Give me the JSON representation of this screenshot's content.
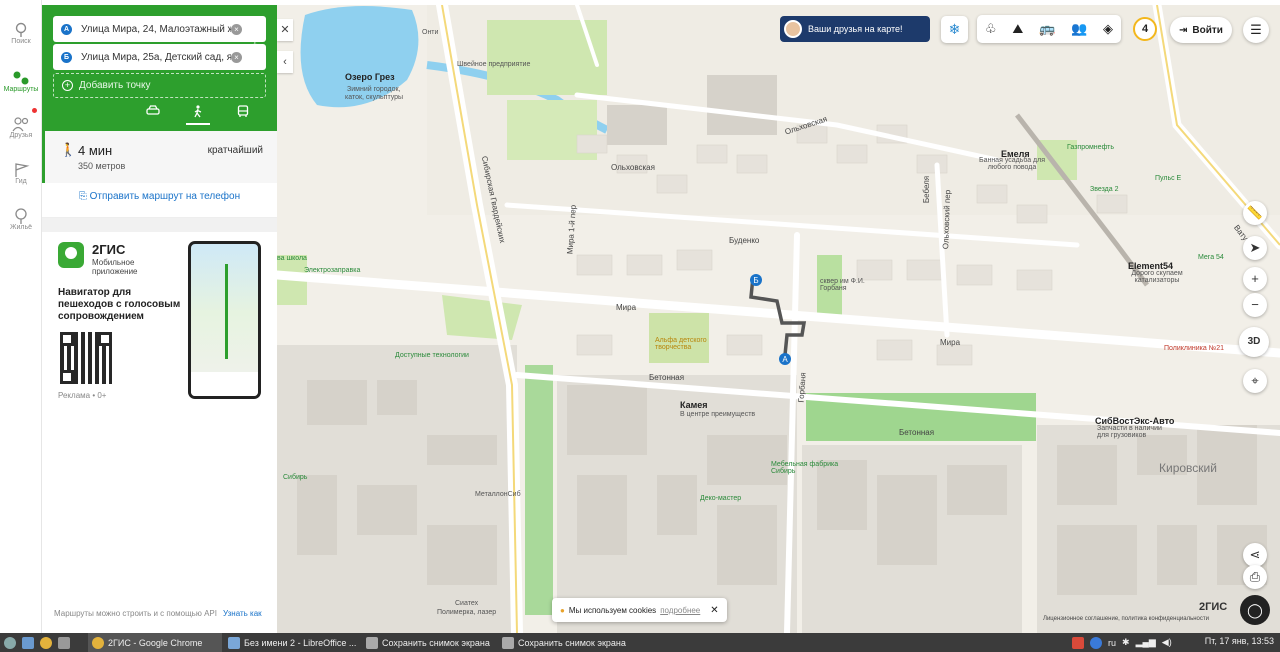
{
  "rail": {
    "items": [
      {
        "label": "Поиск",
        "icon": "search-icon"
      },
      {
        "label": "Маршруты",
        "icon": "routes-icon"
      },
      {
        "label": "Друзья",
        "icon": "friends-icon"
      },
      {
        "label": "Гид",
        "icon": "guide-icon"
      },
      {
        "label": "Жильё",
        "icon": "housing-icon"
      }
    ]
  },
  "route": {
    "point_a": "Улица Мира, 24, Малоэтажный ж",
    "point_b": "Улица Мира, 25а, Детский сад, я",
    "badge_a": "А",
    "badge_b": "Б",
    "add_point": "Добавить точку",
    "modes": [
      "car-icon",
      "walk-icon",
      "bus-icon"
    ],
    "active_mode": "walk-icon",
    "accent_color": "#2d9f2d"
  },
  "result": {
    "time": "4 мин",
    "distance": "350 метров",
    "tag": "кратчайший"
  },
  "send_to_phone": "Отправить маршрут на телефон",
  "ad": {
    "brand": "2ГИС",
    "subtitle": "Мобильное приложение",
    "pitch": "Навигатор для пешеходов с голосовым сопровождением",
    "label": "Реклама • 0+"
  },
  "api": {
    "text": "Маршруты можно строить и с помощью API",
    "link": "Узнать как"
  },
  "map": {
    "friends_banner": "Ваши друзья на карте!",
    "counter": "4",
    "login": "Войти",
    "btn_3d": "3D",
    "cookies_text": "Мы используем cookies",
    "cookies_more": "подробнее",
    "logo": "2ГИС",
    "legal": "Лицензионное соглашение, политика конфиденциальности",
    "labels": {
      "lake": "Озеро Грез",
      "lake_sub1": "Зимний городок,",
      "lake_sub2": "каток, скульптуры",
      "olkhovskaya1": "Ольховская",
      "olkhovskaya2": "Ольховская",
      "budenko": "Буденко",
      "mira_w": "Мира",
      "mira_e": "Мира",
      "betonnaya_w": "Бетонная",
      "betonnaya_e": "Бетонная",
      "sibirskaya": "Сибирская Гвардейских",
      "mira_lane": "Мира 1-й пер",
      "gorbaniya": "Горбаня",
      "square": "сквер им Ф.И. Горбаня",
      "school": "Альфа детского творчества",
      "kamea": "Камея",
      "kamea_sub": "В центре преимуществ",
      "dostupnye": "Доступные технологии",
      "elektrozapravka": "Электрозаправка",
      "metallonsib": "МеталлонСиб",
      "siatex": "Сиатех",
      "siatex_sub": "Полимерка, лазер",
      "mebel": "Мебельная фабрика Сибирь",
      "deko": "Деко-мастер",
      "emelya": "Емеля",
      "emelya_sub": "Банная усадьба для любого повода",
      "gazprom": "Газпромнефть",
      "zvezda": "Звезда 2",
      "pulks": "Пульс Е",
      "element": "Element54",
      "element_sub": "Дорого скупаем катализаторы",
      "mega": "Мега 54",
      "poliklinika": "Поликлиника №21",
      "sibvostek": "СибВостЭкс-Авто",
      "sibvostek_sub": "Запчасти в наличии для грузовиков",
      "kirovsky": "Кировский",
      "shveinoe": "Швейное предприятие",
      "onti": "Онти",
      "sibir_w": "Сибирь",
      "bebelya": "Бебеля",
      "olkhovsky_lane": "Ольховский пер",
      "vatutina": "Ватутина",
      "shkola": "ва школа"
    }
  },
  "taskbar": {
    "items": [
      "2ГИС - Google Chrome",
      "Без имени 2 - LibreOffice ...",
      "Сохранить снимок экрана",
      "Сохранить снимок экрана"
    ],
    "lang": "ru",
    "clock": "Пт, 17 янв, 13:53"
  }
}
